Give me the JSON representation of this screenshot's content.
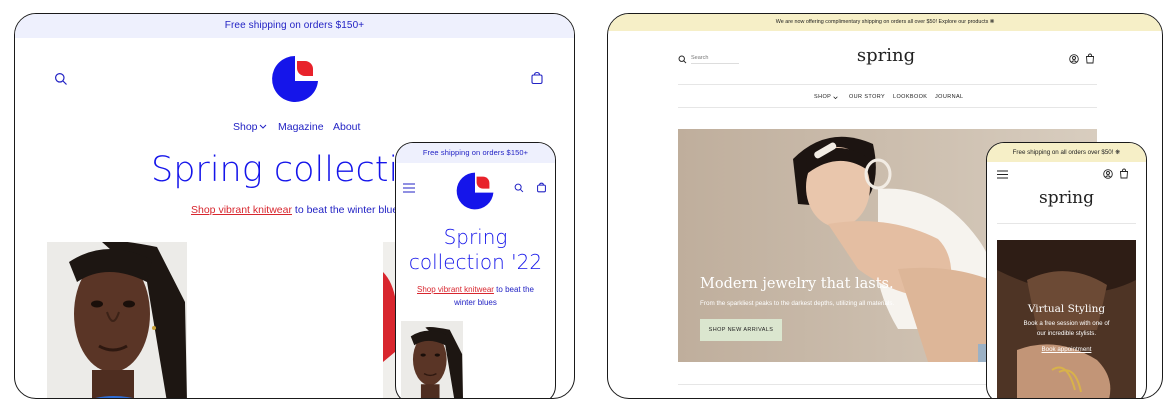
{
  "left_theme": {
    "announcement": "Free shipping on orders $150+",
    "nav": {
      "shop": "Shop",
      "magazine": "Magazine",
      "about": "About"
    },
    "hero_title": "Spring collection '22",
    "hero_link": "Shop vibrant knitwear",
    "hero_rest": " to beat the winter blues",
    "mobile": {
      "announcement": "Free shipping on orders $150+",
      "hero_title_line1": "Spring",
      "hero_title_line2": "collection '22",
      "hero_link": "Shop vibrant knitwear",
      "hero_rest_line1": " to beat the",
      "hero_rest_line2": "winter blues"
    },
    "colors": {
      "accent": "#1515ea",
      "logo_red": "#e8222b",
      "link_red": "#d8262e",
      "announcement_bg": "#eef0fd"
    }
  },
  "right_theme": {
    "announcement": "We are now offering complimentary shipping on orders all over $50! Explore our products ❋",
    "search_placeholder": "Search",
    "logo": "spring",
    "nav": {
      "shop": "SHOP",
      "our_story": "OUR STORY",
      "lookbook": "LOOKBOOK",
      "journal": "JOURNAL"
    },
    "banner_title": "Modern jewelry that lasts.",
    "banner_text": "From the sparkliest peaks to the darkest depths, utilizing all materials.",
    "banner_button": "SHOP NEW ARRIVALS",
    "mobile": {
      "announcement": "Free shipping on all orders over $50! ❋",
      "logo": "spring",
      "card_title": "Virtual Styling",
      "card_text_line1": "Book a free session with one of",
      "card_text_line2": "our incredible stylists.",
      "card_link": "Book appointment"
    },
    "colors": {
      "announcement_bg": "#f6efc7",
      "button_bg": "#dbe6cf"
    }
  }
}
